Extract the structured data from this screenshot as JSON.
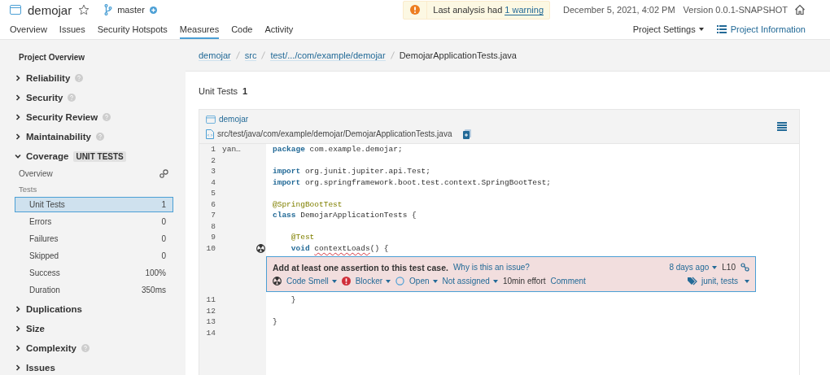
{
  "header": {
    "project": "demojar",
    "branch": "master",
    "warning": {
      "text": "Last analysis had ",
      "link": "1 warning"
    },
    "date": "December 5, 2021, 4:02 PM",
    "version": "Version 0.0.1-SNAPSHOT"
  },
  "nav": {
    "tabs": [
      {
        "label": "Overview",
        "selected": false
      },
      {
        "label": "Issues",
        "selected": false
      },
      {
        "label": "Security Hotspots",
        "selected": false
      },
      {
        "label": "Measures",
        "selected": true
      },
      {
        "label": "Code",
        "selected": false
      },
      {
        "label": "Activity",
        "selected": false
      }
    ],
    "project_settings": "Project Settings",
    "project_information": "Project Information"
  },
  "sidebar": {
    "title": "Project Overview",
    "sections": [
      {
        "label": "Reliability",
        "expanded": false,
        "help": true
      },
      {
        "label": "Security",
        "expanded": false,
        "help": true
      },
      {
        "label": "Security Review",
        "expanded": false,
        "help": true
      },
      {
        "label": "Maintainability",
        "expanded": false,
        "help": true
      },
      {
        "label": "Coverage",
        "expanded": true,
        "help": false,
        "badge": "UNIT TESTS",
        "overview": "Overview",
        "group": "Tests",
        "metrics": [
          {
            "label": "Unit Tests",
            "value": "1",
            "selected": true
          },
          {
            "label": "Errors",
            "value": "0",
            "selected": false
          },
          {
            "label": "Failures",
            "value": "0",
            "selected": false
          },
          {
            "label": "Skipped",
            "value": "0",
            "selected": false
          },
          {
            "label": "Success",
            "value": "100%",
            "selected": false
          },
          {
            "label": "Duration",
            "value": "350ms",
            "selected": false
          }
        ]
      },
      {
        "label": "Duplications",
        "expanded": false,
        "help": false
      },
      {
        "label": "Size",
        "expanded": false,
        "help": false
      },
      {
        "label": "Complexity",
        "expanded": false,
        "help": true
      },
      {
        "label": "Issues",
        "expanded": false,
        "help": false
      }
    ]
  },
  "breadcrumb": [
    {
      "text": "demojar",
      "link": true
    },
    {
      "text": "src",
      "link": true
    },
    {
      "text": "test/.../com/example/demojar",
      "link": true
    },
    {
      "text": "DemojarApplicationTests.java",
      "link": false
    }
  ],
  "heading": {
    "label": "Unit Tests",
    "value": "1"
  },
  "source": {
    "project": "demojar",
    "path": "src/test/java/com/example/demojar/DemojarApplicationTests.java",
    "lines": [
      {
        "number": "1",
        "author": "yan…",
        "issue_marker": false,
        "tokens": [
          {
            "kind": "keyword",
            "text": "package"
          },
          {
            "kind": "plain",
            "text": " com.example.demojar;"
          }
        ]
      },
      {
        "number": "2",
        "issue_marker": false
      },
      {
        "number": "3",
        "issue_marker": false,
        "tokens": [
          {
            "kind": "keyword",
            "text": "import"
          },
          {
            "kind": "plain",
            "text": " org.junit.jupiter.api.Test;"
          }
        ]
      },
      {
        "number": "4",
        "issue_marker": false,
        "tokens": [
          {
            "kind": "keyword",
            "text": "import"
          },
          {
            "kind": "plain",
            "text": " org.springframework.boot.test.context.SpringBootTest;"
          }
        ]
      },
      {
        "number": "5",
        "issue_marker": false
      },
      {
        "number": "6",
        "issue_marker": false,
        "tokens": [
          {
            "kind": "annotation",
            "text": "@SpringBootTest"
          }
        ]
      },
      {
        "number": "7",
        "issue_marker": false,
        "tokens": [
          {
            "kind": "keyword",
            "text": "class"
          },
          {
            "kind": "plain",
            "text": " DemojarApplicationTests {"
          }
        ]
      },
      {
        "number": "8",
        "issue_marker": false
      },
      {
        "number": "9",
        "issue_marker": false,
        "tokens": [
          {
            "kind": "annotation",
            "text": "    @Test"
          }
        ]
      },
      {
        "number": "10",
        "issue_marker": true,
        "tokens": [
          {
            "kind": "keyword",
            "text": "    void "
          },
          {
            "kind": "flagged",
            "text": "contextLoads"
          },
          {
            "kind": "plain",
            "text": "() {"
          }
        ],
        "issue": {
          "message": "Add at least one assertion to this test case.",
          "why": "Why is this an issue?",
          "age": "8 days ago",
          "line": "L10",
          "type": "Code Smell",
          "severity": "Blocker",
          "status": "Open",
          "assignee": "Not assigned",
          "effort": "10min effort",
          "comment": "Comment",
          "tags": "junit, tests"
        }
      },
      {
        "number": "11",
        "issue_marker": false,
        "tokens": [
          {
            "kind": "plain",
            "text": "    }"
          }
        ]
      },
      {
        "number": "12",
        "issue_marker": false
      },
      {
        "number": "13",
        "issue_marker": false,
        "tokens": [
          {
            "kind": "plain",
            "text": "}"
          }
        ]
      },
      {
        "number": "14",
        "issue_marker": false
      }
    ]
  }
}
